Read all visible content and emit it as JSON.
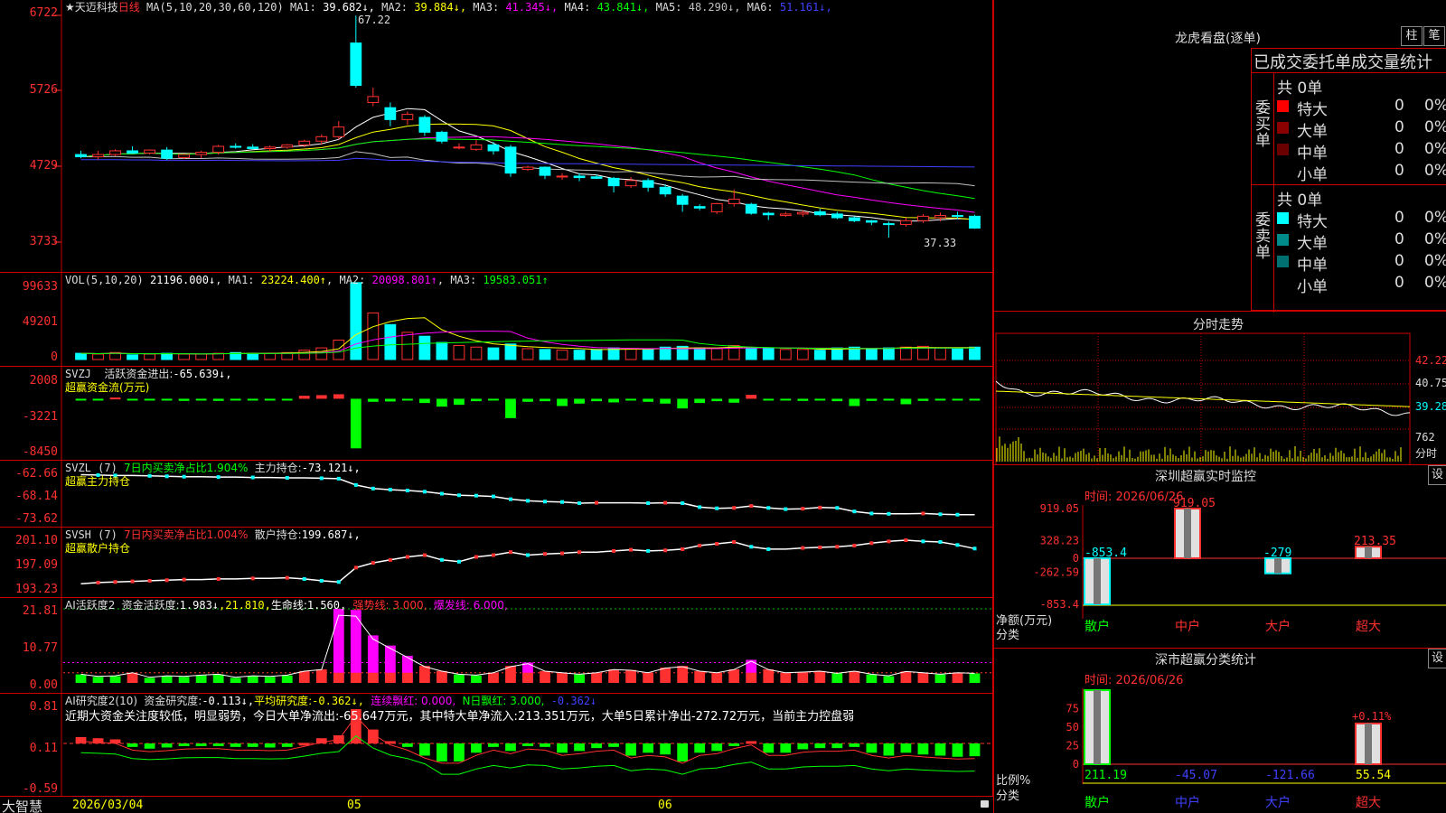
{
  "app": {
    "brand": "大智慧"
  },
  "stock": {
    "name": "★天迈科技",
    "period": "日线",
    "ma_label": "MA(5,10,20,30,60,120)",
    "ma": [
      {
        "t": "MA1:",
        "v": "39.682↓",
        "c": "#ffffff"
      },
      {
        "t": "MA2:",
        "v": "39.884↓",
        "c": "#ffff00"
      },
      {
        "t": "MA3:",
        "v": "41.345↓",
        "c": "#ff00ff"
      },
      {
        "t": "MA4:",
        "v": "43.841↓",
        "c": "#00ff00"
      },
      {
        "t": "MA5:",
        "v": "48.290↓",
        "c": "#c0c0c0"
      },
      {
        "t": "MA6:",
        "v": "51.161↓",
        "c": "#4040ff"
      }
    ],
    "high_label": "67.22",
    "low_label": "37.33",
    "axis": [
      "6722",
      "5726",
      "4729",
      "3733"
    ]
  },
  "volume": {
    "label": "VOL(5,10,20)",
    "value": "21196.000↓",
    "ma": [
      {
        "t": "MA1:",
        "v": "23224.400↑",
        "c": "#ffff00"
      },
      {
        "t": "MA2:",
        "v": "20098.801↑",
        "c": "#ff00ff"
      },
      {
        "t": "MA3:",
        "v": "19583.051↑",
        "c": "#00ff00"
      }
    ],
    "axis": [
      "99633",
      "49201",
      "0"
    ]
  },
  "svzj": {
    "label": "SVZJ",
    "desc": "活跃资金进出:",
    "value": "-65.639↓,",
    "sub": "超赢资金流(万元)",
    "axis": [
      "2008",
      "-3221",
      "-8450"
    ]
  },
  "svzl": {
    "label": "SVZL (7)",
    "ratio": "7日内买卖净占比1.904%",
    "desc": "主力持仓:",
    "value": "-73.121↓,",
    "sub": "超赢主力持仓",
    "axis": [
      "-62.66",
      "-68.14",
      "-73.62"
    ]
  },
  "svsh": {
    "label": "SVSH (7)",
    "ratio": "7日内买卖净占比1.004%",
    "desc": "散户持仓:",
    "value": "199.687↓,",
    "sub": "超赢散户持仓",
    "axis": [
      "201.10",
      "197.09",
      "193.23"
    ]
  },
  "ai_active": {
    "label": "AI活跃度2",
    "desc": "资金活跃度:",
    "value": "1.983↓",
    "v2": ",21.810,",
    "life_label": "生命线:",
    "life": "1.560,",
    "strong": "强势线: 3.000,",
    "burst": "爆发线: 6.000,",
    "axis": [
      "21.81",
      "10.77",
      "0.00"
    ]
  },
  "ai_research": {
    "label": "AI研究度2(10)",
    "desc": "资金研究度:",
    "value": "-0.113↓,",
    "avg_label": "平均研究度:",
    "avg": "-0.362↓,",
    "red": "连续飘红: 0.000,",
    "nred": "N日飘红: 3.000,",
    "last": "-0.362↓",
    "comment": "近期大资金关注度较低，明显弱势，今日大单净流出:-65.647万元，其中特大单净流入:213.351万元，大单5日累计净出-272.72万元，当前主力控盘弱",
    "axis": [
      "0.81",
      "0.11",
      "-0.59"
    ]
  },
  "xaxis": [
    "2026/03/04",
    "05",
    "06"
  ],
  "right": {
    "dragon_title": "龙虎看盘(逐单)",
    "btn1": "柱",
    "btn2": "笔",
    "stats_title": "已成交委托单成交量统计",
    "buy": {
      "side": "委买单",
      "total": "共 0单",
      "rows": [
        {
          "n": "特大",
          "v": "0",
          "p": "0%",
          "c": "#ff0000"
        },
        {
          "n": "大单",
          "v": "0",
          "p": "0%",
          "c": "#8b0000"
        },
        {
          "n": "中单",
          "v": "0",
          "p": "0%",
          "c": "#6b0000"
        },
        {
          "n": "小单",
          "v": "0",
          "p": "0%",
          "c": ""
        }
      ]
    },
    "sell": {
      "side": "委卖单",
      "total": "共 0单",
      "rows": [
        {
          "n": "特大",
          "v": "0",
          "p": "0%",
          "c": "#00ffff"
        },
        {
          "n": "大单",
          "v": "0",
          "p": "0%",
          "c": "#008b8b"
        },
        {
          "n": "中单",
          "v": "0",
          "p": "0%",
          "c": "#007070"
        },
        {
          "n": "小单",
          "v": "0",
          "p": "0%",
          "c": ""
        }
      ]
    },
    "intraday": {
      "title": "分时走势",
      "axis": [
        "42.22",
        "40.75",
        "39.28"
      ],
      "vol": "762",
      "vol_label": "分时"
    },
    "monitor": {
      "title": "深圳超赢实时监控",
      "settings": "设",
      "time": "时间: 2026/06/26",
      "axis": [
        "919.05",
        "328.23",
        "0",
        "-262.59",
        "-853.4"
      ],
      "unit": "净额(万元)",
      "cat_label": "分类",
      "cats": [
        "散户",
        "中户",
        "大户",
        "超大"
      ],
      "values": [
        {
          "label": "-853.4",
          "v": -853.4
        },
        {
          "label": "919.05",
          "v": 919.05
        },
        {
          "label": "-279",
          "v": -279
        },
        {
          "label": "213.35",
          "v": 213.35
        }
      ]
    },
    "classify": {
      "title": "深市超赢分类统计",
      "settings": "设",
      "time": "时间: 2026/06/26",
      "axis": [
        "75",
        "50",
        "25",
        "0"
      ],
      "unit": "比例%",
      "cat_label": "分类",
      "cats": [
        "散户",
        "中户",
        "大户",
        "超大"
      ],
      "pct_label": "+0.11%",
      "values": [
        {
          "label": "211.19",
          "v": 100,
          "c": "#00ff00"
        },
        {
          "label": "-45.07",
          "v": 0,
          "c": "#4040ff"
        },
        {
          "label": "-121.66",
          "v": 0,
          "c": "#4040ff"
        },
        {
          "label": "55.54",
          "v": 55,
          "c": "#ffff00"
        }
      ]
    }
  },
  "chart_data": {
    "type": "candlestick",
    "price_range": [
      37.33,
      67.22
    ],
    "candles": [
      [
        48.5,
        49,
        48,
        48.2
      ],
      [
        48.2,
        49,
        47.8,
        48.5
      ],
      [
        48.5,
        49.2,
        48.3,
        49
      ],
      [
        49,
        49.6,
        48.6,
        48.7
      ],
      [
        48.7,
        49.2,
        48.5,
        49.1
      ],
      [
        49.1,
        49.5,
        47.8,
        48
      ],
      [
        48.1,
        48.6,
        47.9,
        48.5
      ],
      [
        48.5,
        49,
        48,
        48.8
      ],
      [
        48.8,
        49.8,
        48.5,
        49.6
      ],
      [
        49.6,
        50,
        49.3,
        49.5
      ],
      [
        49.5,
        49.9,
        49.2,
        49.3
      ],
      [
        49.3,
        49.7,
        48.9,
        49.5
      ],
      [
        49.5,
        49.9,
        49.3,
        49.8
      ],
      [
        49.8,
        50.5,
        49.5,
        50.3
      ],
      [
        50.3,
        51.2,
        49.8,
        50.9
      ],
      [
        50.9,
        53,
        50.5,
        52.2
      ],
      [
        63.5,
        67.2,
        57.5,
        57.8
      ],
      [
        55.5,
        57.5,
        55,
        56.3
      ],
      [
        54.8,
        55.5,
        52.3,
        53.2
      ],
      [
        53.2,
        54.3,
        52.5,
        53.9
      ],
      [
        53.5,
        53.8,
        51,
        51.5
      ],
      [
        51.5,
        51.7,
        50,
        50.3
      ],
      [
        49.5,
        50,
        49.2,
        49.5
      ],
      [
        49.2,
        50.5,
        49,
        49.8
      ],
      [
        49.8,
        50.2,
        48.5,
        49
      ],
      [
        49.5,
        49.8,
        45.5,
        46
      ],
      [
        46.5,
        47,
        46.3,
        46.8
      ],
      [
        46.8,
        46.9,
        45.2,
        45.7
      ],
      [
        45.5,
        46,
        45.1,
        45.6
      ],
      [
        45.6,
        46,
        44.9,
        45.4
      ],
      [
        45.5,
        45.8,
        45.2,
        45.3
      ],
      [
        45.3,
        45.5,
        43.4,
        44.3
      ],
      [
        44.3,
        45.5,
        44,
        45
      ],
      [
        45,
        45.3,
        43.5,
        44.1
      ],
      [
        44.1,
        44.5,
        42.8,
        43.2
      ],
      [
        42.9,
        43.2,
        40.8,
        41.8
      ],
      [
        41.5,
        41.8,
        41,
        41.3
      ],
      [
        40.8,
        42,
        40.5,
        41.9
      ],
      [
        41.9,
        43.8,
        41.5,
        42.5
      ],
      [
        41.8,
        42,
        40.4,
        40.6
      ],
      [
        40.6,
        40.8,
        39.7,
        40.4
      ],
      [
        40.3,
        40.8,
        40.1,
        40.5
      ],
      [
        40.5,
        41,
        40.1,
        40.7
      ],
      [
        40.8,
        41.2,
        40.2,
        40.4
      ],
      [
        40.5,
        40.8,
        39.8,
        40
      ],
      [
        40,
        40.2,
        39.4,
        39.6
      ],
      [
        39.6,
        39.7,
        39,
        39.4
      ],
      [
        39.2,
        39.5,
        37.33,
        39.1
      ],
      [
        39.1,
        40,
        38.8,
        39.6
      ],
      [
        39.6,
        40.5,
        39.3,
        40.2
      ],
      [
        40,
        40.7,
        39.5,
        40.3
      ],
      [
        40.3,
        40.8,
        39.8,
        40.2
      ],
      [
        40.2,
        40.4,
        38.5,
        38.6
      ]
    ],
    "volume": [
      8,
      7,
      9,
      6,
      7,
      8,
      7,
      7,
      8,
      9,
      8,
      8,
      9,
      12,
      15,
      25,
      99,
      60,
      45,
      35,
      30,
      22,
      18,
      16,
      15,
      20,
      14,
      13,
      12,
      12,
      13,
      15,
      14,
      13,
      16,
      17,
      15,
      14,
      18,
      15,
      14,
      13,
      13,
      12,
      15,
      16,
      14,
      15,
      16,
      17,
      15,
      14,
      16
    ],
    "svzj": [
      -150,
      -200,
      200,
      -180,
      -150,
      -300,
      -350,
      -250,
      -350,
      -200,
      -180,
      -220,
      -150,
      500,
      600,
      750,
      -8200,
      -500,
      -450,
      -300,
      -700,
      -1300,
      -1000,
      -400,
      -250,
      -3200,
      -500,
      -400,
      -1200,
      -800,
      -400,
      -600,
      -300,
      -500,
      -800,
      -1600,
      -700,
      -400,
      -650,
      650,
      -300,
      -250,
      -350,
      -300,
      -400,
      -1200,
      -350,
      -300,
      -900,
      -350,
      -250,
      -300,
      -150
    ],
    "svzl": [
      -63,
      -63.1,
      -63.2,
      -63.2,
      -63.3,
      -63.4,
      -63.5,
      -63.5,
      -63.6,
      -63.6,
      -63.7,
      -63.7,
      -63.8,
      -63.8,
      -63.9,
      -64,
      -65.6,
      -66.5,
      -66.8,
      -67,
      -67.3,
      -67.8,
      -68.2,
      -68.3,
      -68.5,
      -69.2,
      -69.6,
      -69.8,
      -69.9,
      -70.2,
      -70.1,
      -70.1,
      -70.1,
      -70.2,
      -70.1,
      -70.2,
      -71.2,
      -71.5,
      -71.4,
      -70.9,
      -71.4,
      -71.7,
      -71.6,
      -71.3,
      -71.4,
      -72.3,
      -72.8,
      -72.9,
      -72.9,
      -72.8,
      -73,
      -73.1,
      -73.1
    ],
    "svsh": [
      193.8,
      194,
      194.1,
      194.2,
      194.3,
      194.4,
      194.5,
      194.5,
      194.6,
      194.6,
      194.7,
      194.7,
      194.8,
      194.6,
      194.3,
      194.1,
      196.5,
      197.3,
      197.8,
      198.3,
      198.6,
      197.8,
      197.5,
      198.3,
      198.6,
      199.1,
      198.6,
      198.8,
      198.9,
      199.1,
      199.1,
      199.3,
      199.5,
      199.3,
      199.4,
      199.6,
      200.2,
      200.5,
      200.8,
      200,
      199.6,
      199.6,
      199.8,
      199.9,
      200,
      200.2,
      200.6,
      200.9,
      201.1,
      200.9,
      200.8,
      200.3,
      199.7
    ],
    "ai_active": [
      2.5,
      1.8,
      2,
      3,
      1.5,
      2,
      1.8,
      2.2,
      2.5,
      1.5,
      2,
      1.8,
      2.2,
      3.5,
      4,
      21.8,
      21.5,
      14,
      11,
      8,
      5,
      3.5,
      2.5,
      2.2,
      3,
      5,
      6,
      3.5,
      3,
      2.5,
      3,
      4,
      3.8,
      3,
      4.5,
      5,
      3.5,
      3,
      4,
      6.8,
      4,
      3,
      3.2,
      3.5,
      2.8,
      3.5,
      2.5,
      2,
      3.4,
      3,
      2.5,
      3,
      2.8
    ],
    "ai_research": [
      0.22,
      0.2,
      0.18,
      0.05,
      0.02,
      0.04,
      0.07,
      0.08,
      0.08,
      0.05,
      0.05,
      0.04,
      0.05,
      0.12,
      0.2,
      0.25,
      0.7,
      0.35,
      0.15,
      0.05,
      -0.1,
      -0.2,
      -0.2,
      -0.05,
      0.05,
      -0.02,
      0.07,
      0.05,
      -0.05,
      -0.02,
      0.03,
      0.05,
      -0.1,
      -0.05,
      -0.08,
      -0.2,
      -0.05,
      -0.02,
      0.08,
      0.15,
      -0.05,
      -0.05,
      0.01,
      0.03,
      0.03,
      0.05,
      -0.05,
      -0.1,
      -0.05,
      -0.08,
      -0.1,
      -0.12,
      -0.11
    ]
  }
}
